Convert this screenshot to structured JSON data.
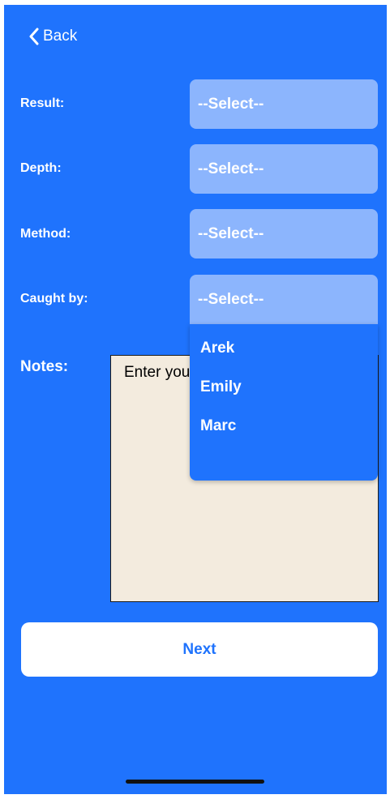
{
  "nav": {
    "back_label": "Back"
  },
  "form": {
    "result_label": "Result:",
    "result_value": "--Select--",
    "depth_label": "Depth:",
    "depth_value": "--Select--",
    "method_label": "Method:",
    "method_value": "--Select--",
    "caught_by_label": "Caught by:",
    "caught_by_value": "--Select--",
    "caught_by_options": [
      "Arek",
      "Emily",
      "Marc"
    ],
    "notes_label": "Notes:",
    "notes_placeholder": "Enter your notes"
  },
  "actions": {
    "next_label": "Next"
  },
  "colors": {
    "background": "#1f73fd",
    "select_bg": "#8cb5fd",
    "notes_bg": "#f3ebde",
    "button_bg": "#ffffff",
    "button_text": "#1f73fd"
  },
  "icons": {
    "back": "chevron-left-icon"
  }
}
